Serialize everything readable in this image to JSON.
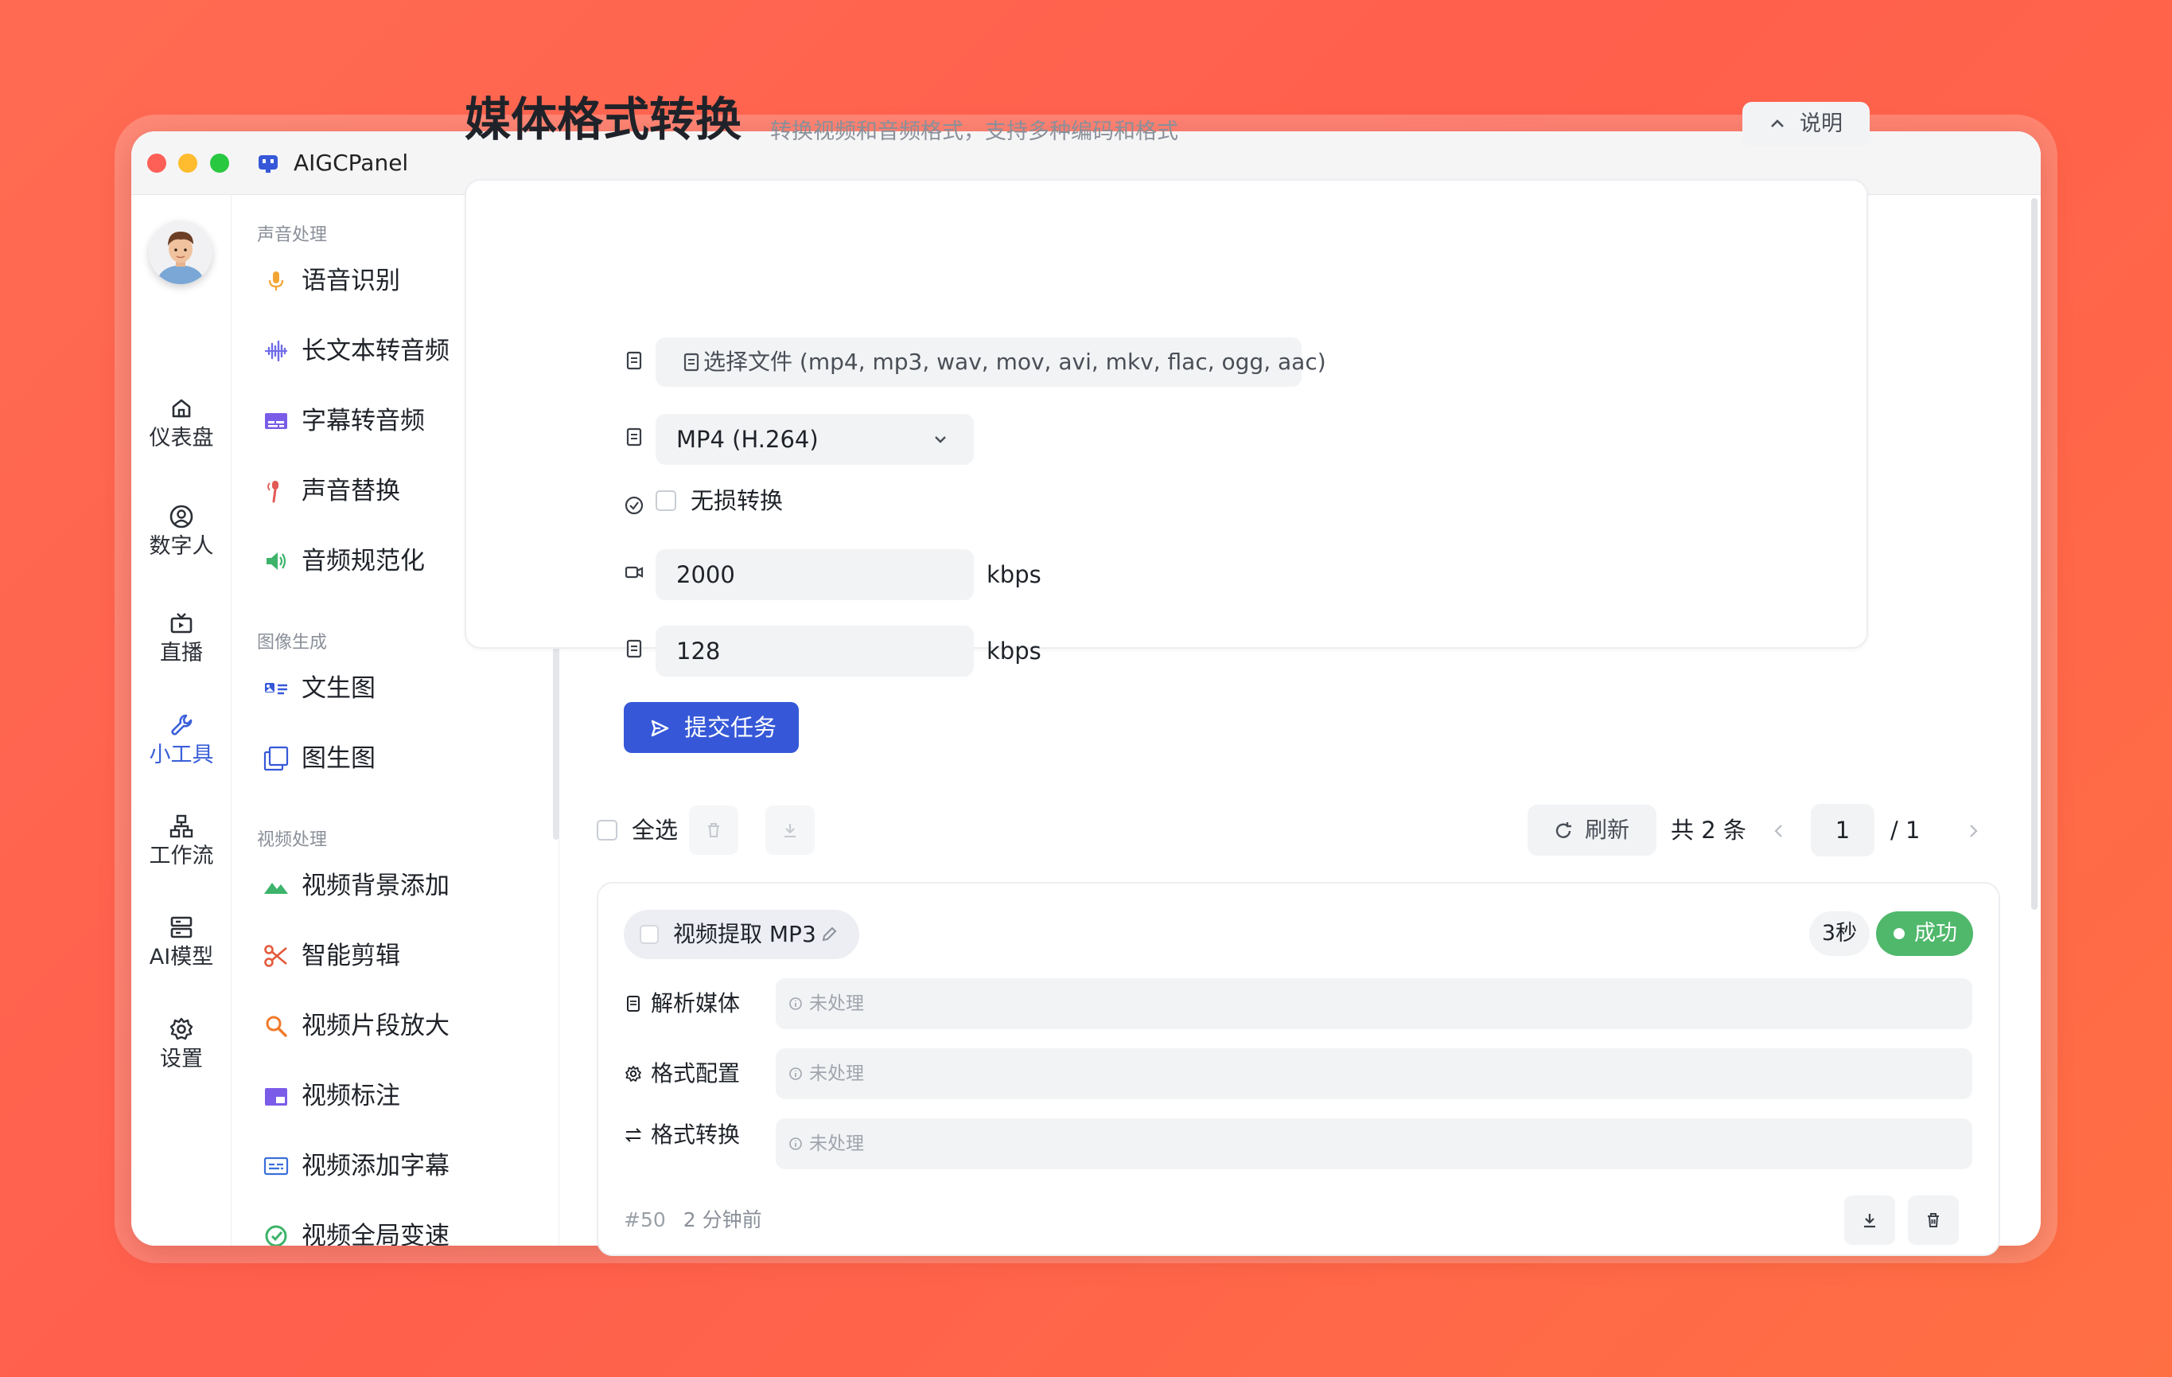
{
  "app": {
    "title": "AIGCPanel"
  },
  "nav": [
    {
      "label": "仪表盘",
      "icon": "home-icon"
    },
    {
      "label": "数字人",
      "icon": "user-circle-icon"
    },
    {
      "label": "直播",
      "icon": "tv-icon"
    },
    {
      "label": "小工具",
      "icon": "wrench-icon",
      "active": true
    },
    {
      "label": "工作流",
      "icon": "workflow-icon"
    },
    {
      "label": "AI模型",
      "icon": "server-icon"
    },
    {
      "label": "设置",
      "icon": "gear-icon"
    }
  ],
  "submenu": {
    "sections": [
      {
        "title": "声音处理",
        "items": [
          "语音识别",
          "长文本转音频",
          "字幕转音频",
          "声音替换",
          "音频规范化"
        ]
      },
      {
        "title": "图像生成",
        "items": [
          "文生图",
          "图生图"
        ]
      },
      {
        "title": "视频处理",
        "items": [
          "视频背景添加",
          "智能剪辑",
          "视频片段放大",
          "视频标注",
          "视频添加字幕",
          "视频全局变速"
        ]
      }
    ]
  },
  "page": {
    "title": "媒体格式转换",
    "subtitle": "转换视频和音频格式，支持多种编码和格式",
    "help_label": "说明"
  },
  "form": {
    "file_button": "选择文件 (mp4, mp3, wav, mov, avi, mkv, flac, ogg, aac)",
    "format_value": "MP4 (H.264)",
    "lossless_label": "无损转换",
    "video_bitrate": "2000",
    "audio_bitrate": "128",
    "unit": "kbps",
    "submit_label": "提交任务"
  },
  "toolbar": {
    "select_all": "全选",
    "refresh": "刷新",
    "total": "共 2 条",
    "page": "1",
    "page_total": "/ 1"
  },
  "task": {
    "title": "视频提取 MP3",
    "duration": "3秒",
    "status": "成功",
    "steps": [
      {
        "label": "解析媒体",
        "status": "未处理"
      },
      {
        "label": "格式配置",
        "status": "未处理"
      },
      {
        "label": "格式转换",
        "status": "未处理"
      }
    ],
    "id": "#50",
    "time": "2 分钟前"
  },
  "colors": {
    "accent": "#3658d8",
    "success": "#4fb86b",
    "background": "#ff6b52"
  }
}
